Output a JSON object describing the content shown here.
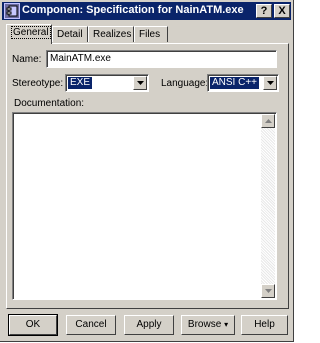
{
  "window": {
    "title": "Componen: Specification for NainATM.exe",
    "help_label": "?",
    "close_label": "X"
  },
  "tabs": [
    {
      "label": "General"
    },
    {
      "label": "Detail"
    },
    {
      "label": "Realizes"
    },
    {
      "label": "Files"
    }
  ],
  "form": {
    "name_label": "Name:",
    "name_value": "MainATM.exe",
    "stereotype_label": "Stereotype:",
    "stereotype_value": "EXE",
    "language_label": "Language:",
    "language_value": "ANSI C++",
    "documentation_label": "Documentation:"
  },
  "buttons": {
    "ok": "OK",
    "cancel": "Cancel",
    "apply": "Apply",
    "browse": "Browse",
    "help": "Help"
  }
}
